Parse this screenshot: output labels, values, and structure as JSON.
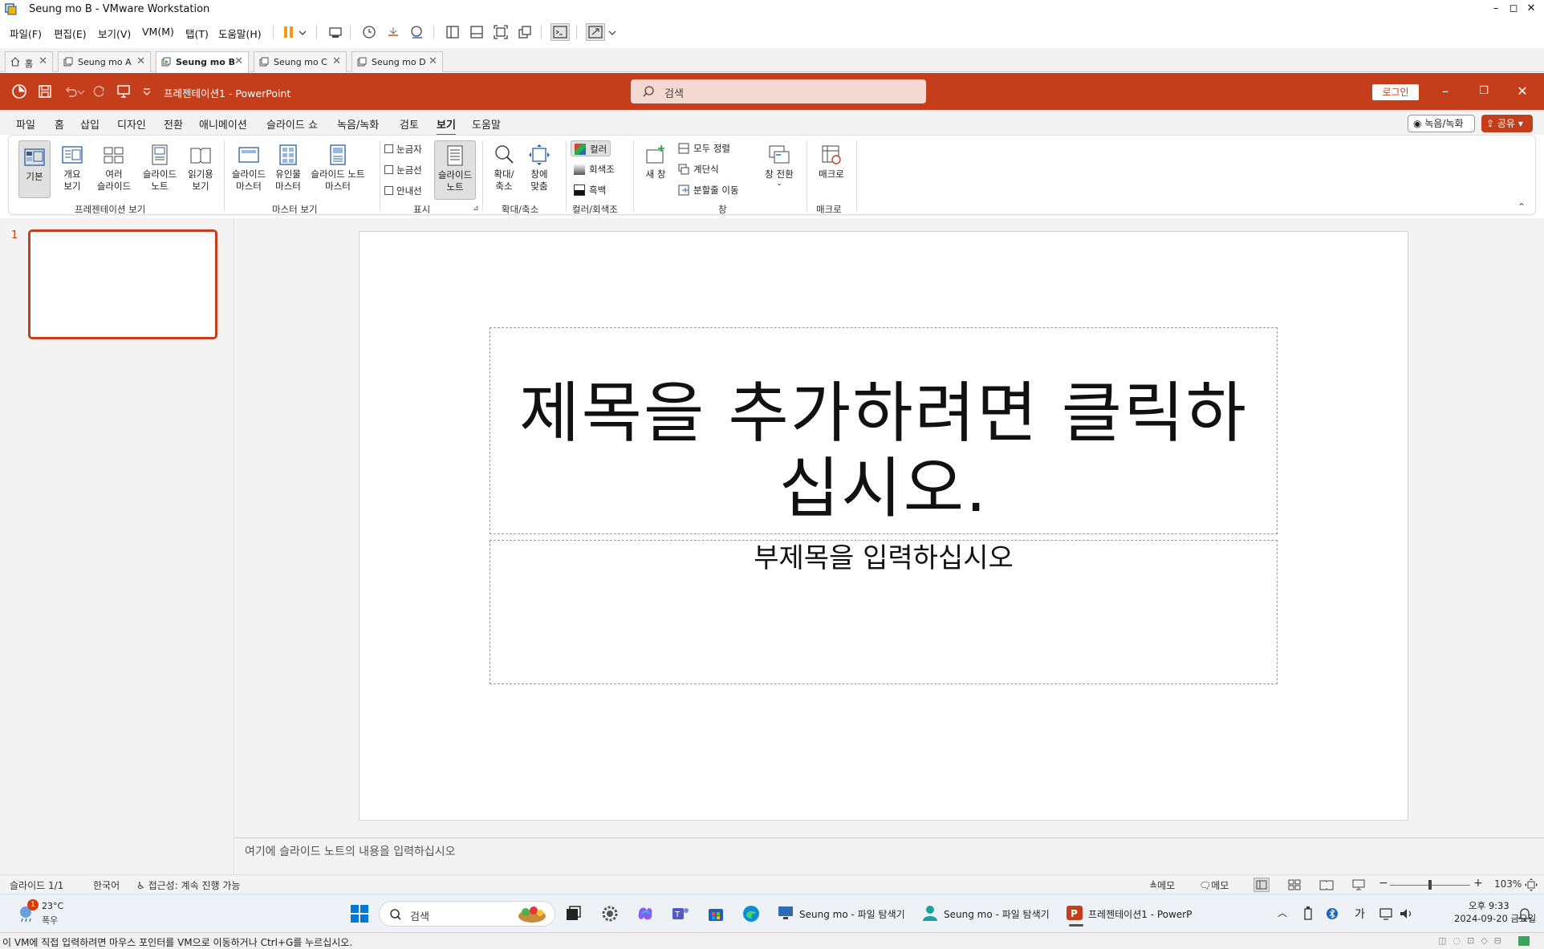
{
  "vmware": {
    "window_title": "Seung mo B - VMware Workstation",
    "menu": [
      "파일(F)",
      "편집(E)",
      "보기(V)",
      "VM(M)",
      "탭(T)",
      "도움말(H)"
    ],
    "tabs": [
      {
        "label": "홈",
        "active": false
      },
      {
        "label": "Seung mo A",
        "active": false
      },
      {
        "label": "Seung mo B",
        "active": true
      },
      {
        "label": "Seung mo C",
        "active": false
      },
      {
        "label": "Seung mo D",
        "active": false
      }
    ],
    "bottom_hint": "이 VM에 직접 입력하려면 마우스 포인터를 VM으로 이동하거나 Ctrl+G를 누르십시오."
  },
  "powerpoint": {
    "doc_title": "프레젠테이션1  -  PowerPoint",
    "search_placeholder": "검색",
    "login_label": "로그인",
    "ribbon_tabs": [
      "파일",
      "홈",
      "삽입",
      "디자인",
      "전환",
      "애니메이션",
      "슬라이드 쇼",
      "녹음/녹화",
      "검토",
      "보기",
      "도움말"
    ],
    "active_tab": "보기",
    "record_label": "녹음/녹화",
    "share_label": "공유",
    "ribbon": {
      "presentation_views": {
        "label": "프레젠테이션 보기",
        "buttons": [
          "기본",
          "개요\n보기",
          "여러\n슬라이드",
          "슬라이드\n노트",
          "읽기용\n보기"
        ]
      },
      "master_views": {
        "label": "마스터 보기",
        "buttons": [
          "슬라이드\n마스터",
          "유인물\n마스터",
          "슬라이드 노트\n마스터"
        ]
      },
      "show": {
        "label": "표시",
        "checkboxes": [
          "눈금자",
          "눈금선",
          "안내선"
        ],
        "notes_button": "슬라이드\n노트"
      },
      "zoom": {
        "label": "확대/축소",
        "buttons": [
          "확대/\n축소",
          "창에\n맞춤"
        ]
      },
      "color": {
        "label": "컬러/회색조",
        "options": [
          "컬러",
          "회색조",
          "흑백"
        ]
      },
      "window": {
        "label": "창",
        "new_window": "새 창",
        "options": [
          "모두 정렬",
          "계단식",
          "분할줄 이동"
        ],
        "switch": "창 전환"
      },
      "macro": {
        "label": "매크로",
        "button": "매크로"
      }
    },
    "slide_number": "1",
    "slide": {
      "title_line1": "제목을 추가하려면 클릭하",
      "title_line2": "십시오.",
      "subtitle": "부제목을 입력하십시오"
    },
    "notes_placeholder": "여기에 슬라이드 노트의 내용을 입력하십시오",
    "status": {
      "slide_count": "슬라이드 1/1",
      "language": "한국어",
      "accessibility": "접근성: 계속 진행 가능",
      "notes_btn": "메모",
      "comments_btn": "메모",
      "zoom": "103%"
    }
  },
  "taskbar": {
    "weather_temp": "23°C",
    "weather_desc": "폭우",
    "weather_badge": "1",
    "search_label": "검색",
    "apps": [
      "Seung mo - 파일 탐색기",
      "Seung mo - 파일 탐색기",
      "프레젠테이션1 - PowerP"
    ],
    "ime": "가",
    "time": "오후 9:33",
    "date": "2024-09-20 금요일"
  },
  "colors": {
    "ppt_accent": "#c43e1c",
    "ppt_search_bg": "#f3d9d1"
  }
}
